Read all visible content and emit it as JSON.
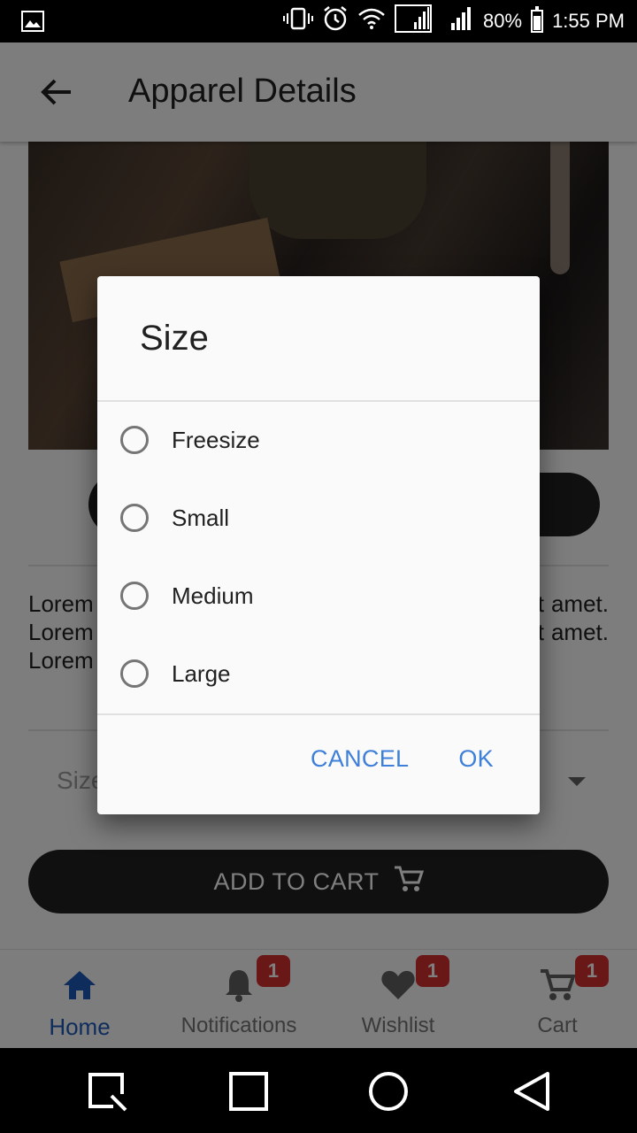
{
  "status_bar": {
    "battery": "80%",
    "time": "1:55 PM"
  },
  "app_bar": {
    "title": "Apparel Details"
  },
  "product": {
    "description": "Lorem ipsum dolor sit amet. Lorem ipsum dolor sit amet. Lorem ipsum dolor sit amet. Lorem ipsum dolor sit amet. Lorem ipsum",
    "size_label": "Size",
    "add_to_cart_label": "ADD TO CART"
  },
  "dialog": {
    "title": "Size",
    "options": [
      "Freesize",
      "Small",
      "Medium",
      "Large"
    ],
    "cancel_label": "CANCEL",
    "ok_label": "OK"
  },
  "bottom_nav": {
    "items": [
      {
        "label": "Home",
        "icon": "home-icon",
        "badge": ""
      },
      {
        "label": "Notifications",
        "icon": "bell-icon",
        "badge": "1"
      },
      {
        "label": "Wishlist",
        "icon": "heart-icon",
        "badge": "1"
      },
      {
        "label": "Cart",
        "icon": "cart-icon",
        "badge": "1"
      }
    ]
  },
  "colors": {
    "accent": "#1e5bb8",
    "dialog_button": "#3d7fd9",
    "badge": "#d32f2f",
    "button_dark": "#212121"
  }
}
